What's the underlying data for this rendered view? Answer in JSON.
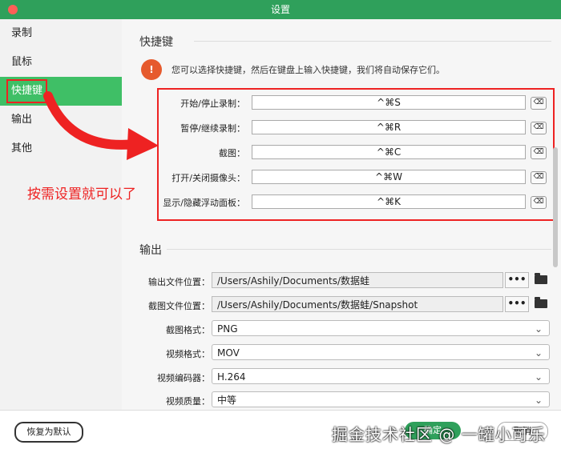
{
  "window": {
    "title": "设置"
  },
  "sidebar": {
    "items": [
      {
        "label": "录制"
      },
      {
        "label": "鼠标"
      },
      {
        "label": "快捷键"
      },
      {
        "label": "输出"
      },
      {
        "label": "其他"
      }
    ]
  },
  "shortcuts": {
    "title": "快捷键",
    "hint": "您可以选择快捷键，然后在键盘上输入快捷键，我们将自动保存它们。",
    "warn_glyph": "!",
    "clear_glyph": "⌫",
    "rows": [
      {
        "label": "开始/停止录制：",
        "value": "^⌘S"
      },
      {
        "label": "暂停/继续录制：",
        "value": "^⌘R"
      },
      {
        "label": "截图：",
        "value": "^⌘C"
      },
      {
        "label": "打开/关闭摄像头：",
        "value": "^⌘W"
      },
      {
        "label": "显示/隐藏浮动面板：",
        "value": "^⌘K"
      }
    ]
  },
  "output": {
    "title": "输出",
    "output_path_label": "输出文件位置：",
    "output_path": "/Users/Ashily/Documents/数据蛙",
    "screenshot_path_label": "截图文件位置：",
    "screenshot_path": "/Users/Ashily/Documents/数据蛙/Snapshot",
    "dots": "•••",
    "selects": [
      {
        "label": "截图格式：",
        "value": "PNG"
      },
      {
        "label": "视频格式：",
        "value": "MOV"
      },
      {
        "label": "视频编码器：",
        "value": "H.264"
      },
      {
        "label": "视频质量：",
        "value": "中等"
      }
    ],
    "chevron": "⌄"
  },
  "footer": {
    "reset": "恢复为默认",
    "confirm": "确定",
    "cancel": "取消"
  },
  "annotation": {
    "text": "按需设置就可以了"
  },
  "watermark": "掘金技术社区 @ 一罐小可乐",
  "colors": {
    "accent": "#2fa05b",
    "highlight": "#e22222",
    "warn": "#e65a2d"
  }
}
